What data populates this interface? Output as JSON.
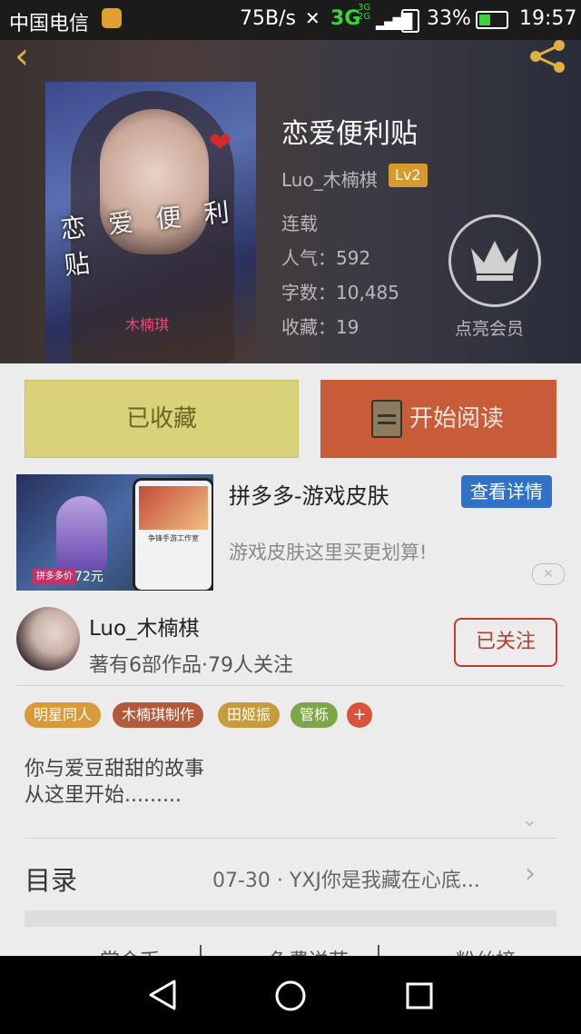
{
  "status_bar": {
    "carrier": "中国电信",
    "speed": "75B/s",
    "network": "3G",
    "network_small": "3G 2G",
    "battery": "33%",
    "time": "19:57"
  },
  "book": {
    "title": "恋爱便利贴",
    "author": "Luo_木楠棋",
    "level": "Lv2",
    "status": "连载",
    "popularity": "人气：592",
    "word_count": "字数：10,485",
    "favorites": "收藏：19",
    "member_label": "点亮会员",
    "cover_title": "恋 爱 便 利 贴",
    "cover_author": "木楠琪"
  },
  "actions": {
    "collected_label": "已收藏",
    "read_label": "开始阅读"
  },
  "ad": {
    "title": "拼多多-游戏皮肤",
    "detail_button": "查看详情",
    "description": "游戏皮肤这里买更划算!",
    "image_price": "72元",
    "image_store": "拼多多价",
    "image_banner": "争锋手游工作室"
  },
  "author_card": {
    "name": "Luo_木楠棋",
    "stats": "著有6部作品·79人关注",
    "follow_button": "已关注"
  },
  "tags": [
    {
      "label": "明星同人",
      "color": "#d99a3a"
    },
    {
      "label": "木楠琪制作",
      "color": "#b45a3c"
    },
    {
      "label": "田姬振",
      "color": "#c79a3b"
    },
    {
      "label": "管栎",
      "color": "#7da54a"
    }
  ],
  "add_tag": "+",
  "synopsis": {
    "line1": "你与爱豆甜甜的故事",
    "line2": "从这里开始........."
  },
  "catalog": {
    "label": "目录",
    "latest": "07-30 · YXJ你是我藏在心底..."
  },
  "bottom_tabs": [
    "赏金币",
    "免费送花",
    "粉丝榜"
  ]
}
